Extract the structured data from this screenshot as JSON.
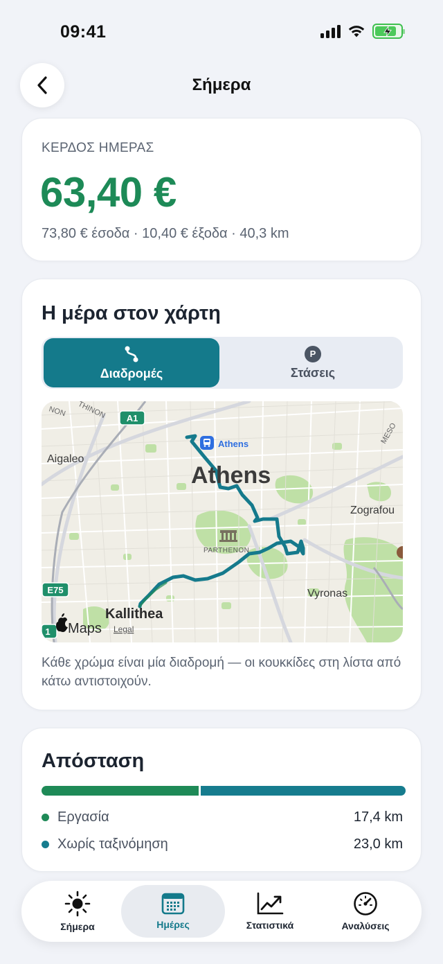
{
  "status": {
    "time": "09:41"
  },
  "header": {
    "title": "Σήμερα"
  },
  "profit": {
    "label": "ΚΕΡΔΟΣ ΗΜΕΡΑΣ",
    "amount": "63,40 €",
    "summary": "73,80 € έσοδα · 10,40 € έξοδα · 40,3 km"
  },
  "map": {
    "title": "Η μέρα στον χάρτη",
    "segments": [
      {
        "label": "Διαδρομές",
        "icon": "route-icon",
        "selected": true
      },
      {
        "label": "Στάσεις",
        "icon": "parking-icon",
        "badge": "P",
        "selected": false
      }
    ],
    "labels": {
      "athens_big": "Athens",
      "athens_station": "Athens",
      "aigaleo": "Aigaleo",
      "zografou": "Zografou",
      "parthenon": "PARTHENON",
      "vyronas": "Vyronas",
      "kallithea": "Kallithea",
      "road_a1": "A1",
      "road_e75": "E75",
      "road_1": "1",
      "edge_left": "NON",
      "edge_top": "THINON",
      "edge_right": "MESO",
      "brand": "Maps",
      "legal": "Legal"
    },
    "caption": "Κάθε χρώμα είναι μία διαδρομή — οι κουκκίδες στη λίστα από κάτω αντιστοιχούν.",
    "route_color": "#157a8c"
  },
  "distance": {
    "title": "Απόσταση",
    "items": [
      {
        "label": "Εργασία",
        "value": "17,4 km",
        "km": 17.4,
        "color": "#1e8a57"
      },
      {
        "label": "Χωρίς ταξινόμηση",
        "value": "23,0 km",
        "km": 23.0,
        "color": "#167c8e"
      }
    ]
  },
  "tabs": [
    {
      "label": "Σήμερα",
      "icon": "sun-icon",
      "selected": false
    },
    {
      "label": "Ημέρες",
      "icon": "calendar-icon",
      "selected": true
    },
    {
      "label": "Στατιστικά",
      "icon": "chart-icon",
      "selected": false
    },
    {
      "label": "Αναλύσεις",
      "icon": "gauge-icon",
      "selected": false
    }
  ]
}
